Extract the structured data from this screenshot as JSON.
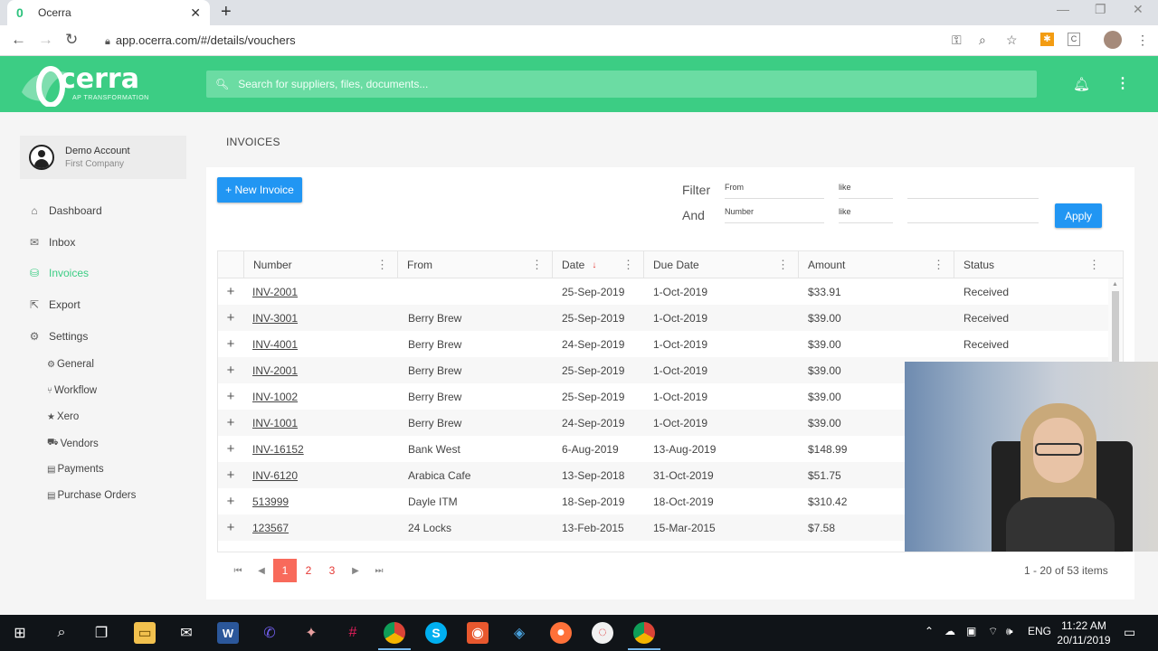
{
  "browser": {
    "tab_title": "Ocerra",
    "tab_close": "✕",
    "new_tab": "+",
    "url": "app.ocerra.com/#/details/vouchers"
  },
  "header": {
    "logo_text": "cerra",
    "logo_sub": "AP TRANSFORMATION",
    "search_placeholder": "Search for suppliers, files, documents...",
    "accent": "#3ccd84"
  },
  "account": {
    "name": "Demo Account",
    "company": "First Company"
  },
  "sidebar": {
    "items": [
      {
        "label": "Dashboard",
        "icon": "home-icon"
      },
      {
        "label": "Inbox",
        "icon": "inbox-icon"
      },
      {
        "label": "Invoices",
        "icon": "basket-icon",
        "active": true
      },
      {
        "label": "Export",
        "icon": "export-icon"
      },
      {
        "label": "Settings",
        "icon": "gear-icon"
      }
    ],
    "sub_items": [
      {
        "label": "General",
        "icon": "gear-icon"
      },
      {
        "label": "Workflow",
        "icon": "workflow-icon"
      },
      {
        "label": "Xero",
        "icon": "star-icon"
      },
      {
        "label": "Vendors",
        "icon": "vendors-icon"
      },
      {
        "label": "Payments",
        "icon": "list-icon"
      },
      {
        "label": "Purchase Orders",
        "icon": "list-icon"
      }
    ]
  },
  "page": {
    "title": "INVOICES",
    "new_invoice": "+ New Invoice",
    "filter_label": "Filter",
    "and_label": "And",
    "filter_field1": "From",
    "filter_op1": "like",
    "filter_field2": "Number",
    "filter_op2": "like",
    "apply": "Apply"
  },
  "grid": {
    "columns": [
      "Number",
      "From",
      "Date",
      "Due Date",
      "Amount",
      "Status"
    ],
    "rows": [
      [
        "INV-2001",
        "",
        "25-Sep-2019",
        "1-Oct-2019",
        "$33.91",
        "Received"
      ],
      [
        "INV-3001",
        "Berry Brew",
        "25-Sep-2019",
        "1-Oct-2019",
        "$39.00",
        "Received"
      ],
      [
        "INV-4001",
        "Berry Brew",
        "24-Sep-2019",
        "1-Oct-2019",
        "$39.00",
        "Received"
      ],
      [
        "INV-2001",
        "Berry Brew",
        "25-Sep-2019",
        "1-Oct-2019",
        "$39.00",
        ""
      ],
      [
        "INV-1002",
        "Berry Brew",
        "25-Sep-2019",
        "1-Oct-2019",
        "$39.00",
        ""
      ],
      [
        "INV-1001",
        "Berry Brew",
        "24-Sep-2019",
        "1-Oct-2019",
        "$39.00",
        ""
      ],
      [
        "INV-16152",
        "Bank West",
        "6-Aug-2019",
        "13-Aug-2019",
        "$148.99",
        ""
      ],
      [
        "INV-6120",
        "Arabica Cafe",
        "13-Sep-2018",
        "31-Oct-2019",
        "$51.75",
        ""
      ],
      [
        "513999",
        "Dayle ITM",
        "18-Sep-2019",
        "18-Oct-2019",
        "$310.42",
        ""
      ],
      [
        "123567",
        "24 Locks",
        "13-Feb-2015",
        "15-Mar-2015",
        "$7.58",
        ""
      ]
    ]
  },
  "pager": {
    "pages": [
      "1",
      "2",
      "3"
    ],
    "current": "1",
    "summary": "1 - 20 of 53 items"
  },
  "taskbar": {
    "lang": "ENG",
    "time": "11:22 AM",
    "date": "20/11/2019"
  }
}
